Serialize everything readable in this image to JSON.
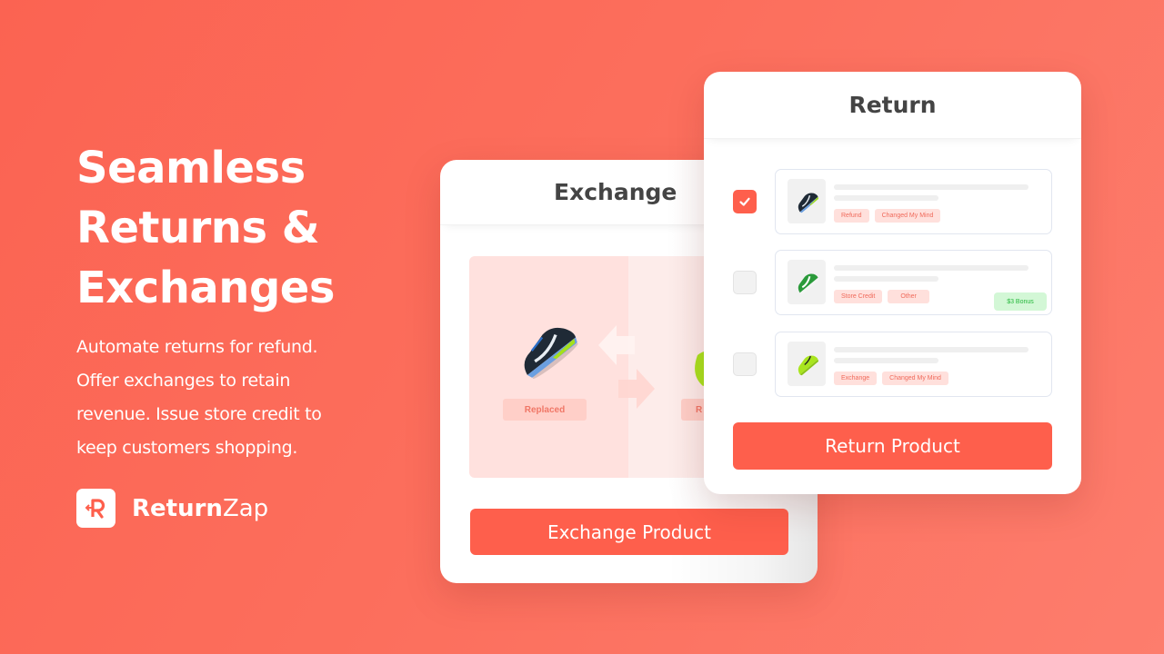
{
  "hero": {
    "title_lines": [
      "Seamless",
      "Returns &",
      "Exchanges"
    ],
    "description_lines": [
      "Automate returns for refund.",
      "Offer exchanges to retain",
      "revenue. Issue store credit to",
      "keep customers shopping."
    ]
  },
  "brand": {
    "name_bold": "Return",
    "name_light": "Zap",
    "logo_icon": "returnzap-r-arrow-icon"
  },
  "exchange_card": {
    "title": "Exchange",
    "left_product": {
      "icon": "shoe-dark-blue-icon",
      "label": "Replaced"
    },
    "right_product": {
      "icon": "shoe-neon-green-icon",
      "label": "R"
    },
    "swap_icon": "swap-arrows-icon",
    "button_label": "Exchange Product"
  },
  "return_card": {
    "title": "Return",
    "items": [
      {
        "checked": true,
        "image": "shoe-dark-blue-icon",
        "tags": [
          "Refund",
          "Changed My Mind"
        ],
        "bonus": null
      },
      {
        "checked": false,
        "image": "shoe-green-white-icon",
        "tags": [
          "Store Credit",
          "Other"
        ],
        "bonus": "$3 Bonus"
      },
      {
        "checked": false,
        "image": "shoe-neon-green-icon",
        "tags": [
          "Exchange",
          "Changed My Mind"
        ],
        "bonus": null
      }
    ],
    "button_label": "Return Product"
  },
  "colors": {
    "brand": "#fe5f4c",
    "background": "#fc6e5c",
    "tag_bg": "#ffe0dc",
    "tag_text": "#f06a5b",
    "bonus_bg": "#d3f7d6",
    "bonus_text": "#25b83b",
    "heading_text": "#444444"
  }
}
